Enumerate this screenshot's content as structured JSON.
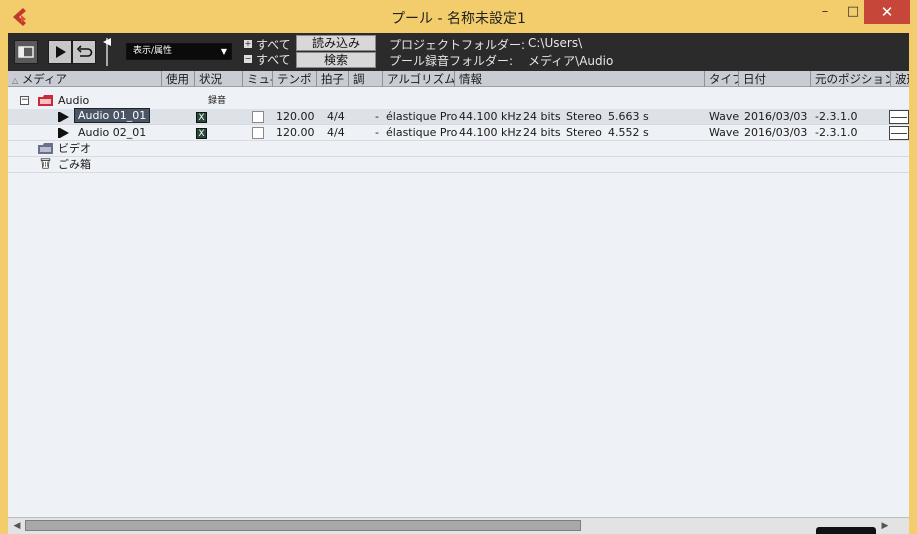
{
  "window": {
    "title": "プール - 名称未設定1",
    "minimize_label": "–",
    "maximize_label": "□",
    "close_label": "✕"
  },
  "toolbar": {
    "view_dropdown": "表示/属性",
    "all_plus": "すべて",
    "all_minus": "すべて",
    "import_button": "読み込み",
    "search_button": "検索",
    "project_folder_label": "プロジェクトフォルダー:",
    "project_folder_path": "C:\\Users\\",
    "record_folder_label": "プール録音フォルダー:",
    "record_folder_path": "メディア\\Audio"
  },
  "columns": {
    "media": "メディア",
    "used": "使用",
    "status": "状況",
    "mute": "ミュ-",
    "tempo": "テンポ",
    "signature": "拍子",
    "key": "調",
    "algorithm": "アルゴリズム",
    "info": "情報",
    "type": "タイプ",
    "date": "日付",
    "origin": "元のポジション",
    "wave": "波形"
  },
  "tree": {
    "audio_folder": "Audio",
    "record_label": "録音",
    "video_folder": "ビデオ",
    "trash_folder": "ごみ箱"
  },
  "clips": [
    {
      "name": "Audio 01_01",
      "status": "X",
      "tempo": "120.00",
      "signature": "4/4",
      "key": "-",
      "algorithm": "élastique Pro",
      "rate": "44.100 kHz",
      "bits": "24 bits",
      "channels": "Stereo",
      "length": "5.663 s",
      "type": "Wave",
      "date": "2016/03/03",
      "origin": "-2.3.1.0"
    },
    {
      "name": "Audio 02_01",
      "status": "X",
      "tempo": "120.00",
      "signature": "4/4",
      "key": "-",
      "algorithm": "élastique Pro",
      "rate": "44.100 kHz",
      "bits": "24 bits",
      "channels": "Stereo",
      "length": "4.552 s",
      "type": "Wave",
      "date": "2016/03/03",
      "origin": "-2.3.1.0"
    }
  ],
  "colors": {
    "titlebar": "#f3cd6c",
    "toolbar": "#2b2b2b",
    "list_bg": "#eef1f5",
    "selection": "#4a5566",
    "close": "#c7463a",
    "audio_folder_icon": "#cc2a3a",
    "app_icon": "#c0392b"
  },
  "icons": {
    "app": "cubase-logo-icon",
    "layout": "layout-toggle-icon",
    "play": "play-icon",
    "loop": "loop-icon",
    "volume": "volume-fader-icon",
    "folder": "folder-icon",
    "trash": "trash-icon",
    "clip": "clip-play-icon"
  }
}
